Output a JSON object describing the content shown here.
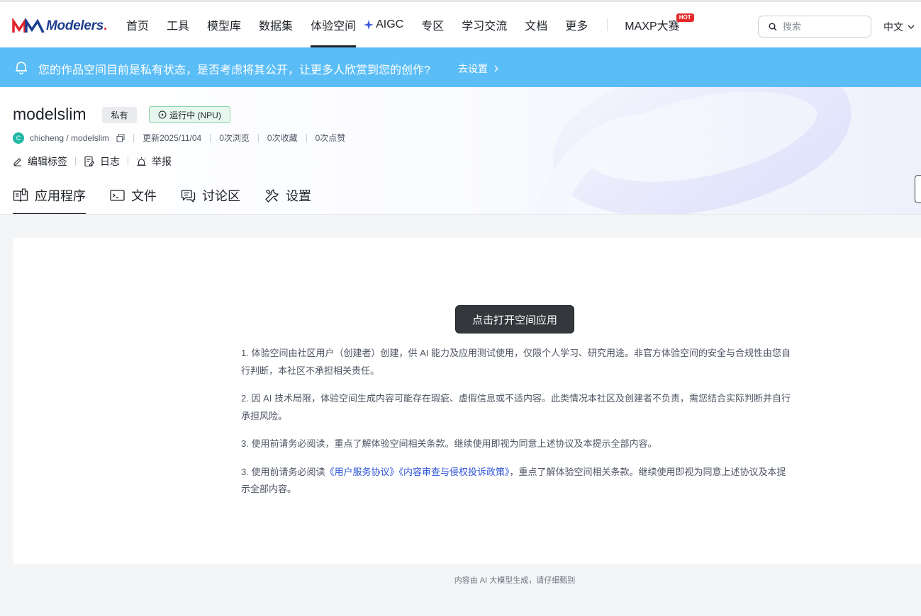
{
  "nav": {
    "logo_text": "Modelers",
    "items": [
      "首页",
      "工具",
      "模型库",
      "数据集",
      "体验空间",
      "AIGC",
      "专区",
      "学习交流",
      "文档",
      "更多"
    ],
    "maxp_label": "MAXP大赛",
    "hot_badge": "HOT",
    "search_placeholder": "搜索",
    "language": "中文",
    "active_item": "体验空间"
  },
  "banner": {
    "text": "您的作品空间目前是私有状态，是否考虑将其公开，让更多人欣赏到您的创作?",
    "link_label": "去设置",
    "color": "#5bbdf6"
  },
  "space": {
    "name": "modelslim",
    "visibility": "私有",
    "status": "运行中 (NPU)",
    "avatar_letter": "C",
    "path": "chicheng / modelslim",
    "updated": "更新2025/11/04",
    "views": "0次浏览",
    "favorites": "0次收藏",
    "likes": "0次点赞",
    "actions": [
      "编辑标签",
      "日志",
      "举报"
    ]
  },
  "tabs": [
    "应用程序",
    "文件",
    "讨论区",
    "设置"
  ],
  "main": {
    "open_button": "点击打开空间应用",
    "terms": [
      "1. 体验空间由社区用户（创建者）创建，供 AI 能力及应用测试使用，仅限个人学习、研究用途。非官方体验空间的安全与合规性由您自行判断，本社区不承担相关责任。",
      "2. 因 AI 技术局限，体验空间生成内容可能存在瑕疵、虚假信息或不适内容。此类情况本社区及创建者不负责，需您结合实际判断并自行承担风险。",
      "3. 使用前请务必阅读，重点了解体验空间相关条款。继续使用即视为同意上述协议及本提示全部内容。"
    ],
    "term4_prefix": "3. 使用前请务必阅读",
    "term4_link1": "《用户服务协议》",
    "term4_link2": "《内容审查与侵权投诉政策》",
    "term4_suffix": "，重点了解体验空间相关条款。继续使用即视为同意上述协议及本提示全部内容。"
  },
  "footer": "内容由 AI 大模型生成，请仔细甄别"
}
